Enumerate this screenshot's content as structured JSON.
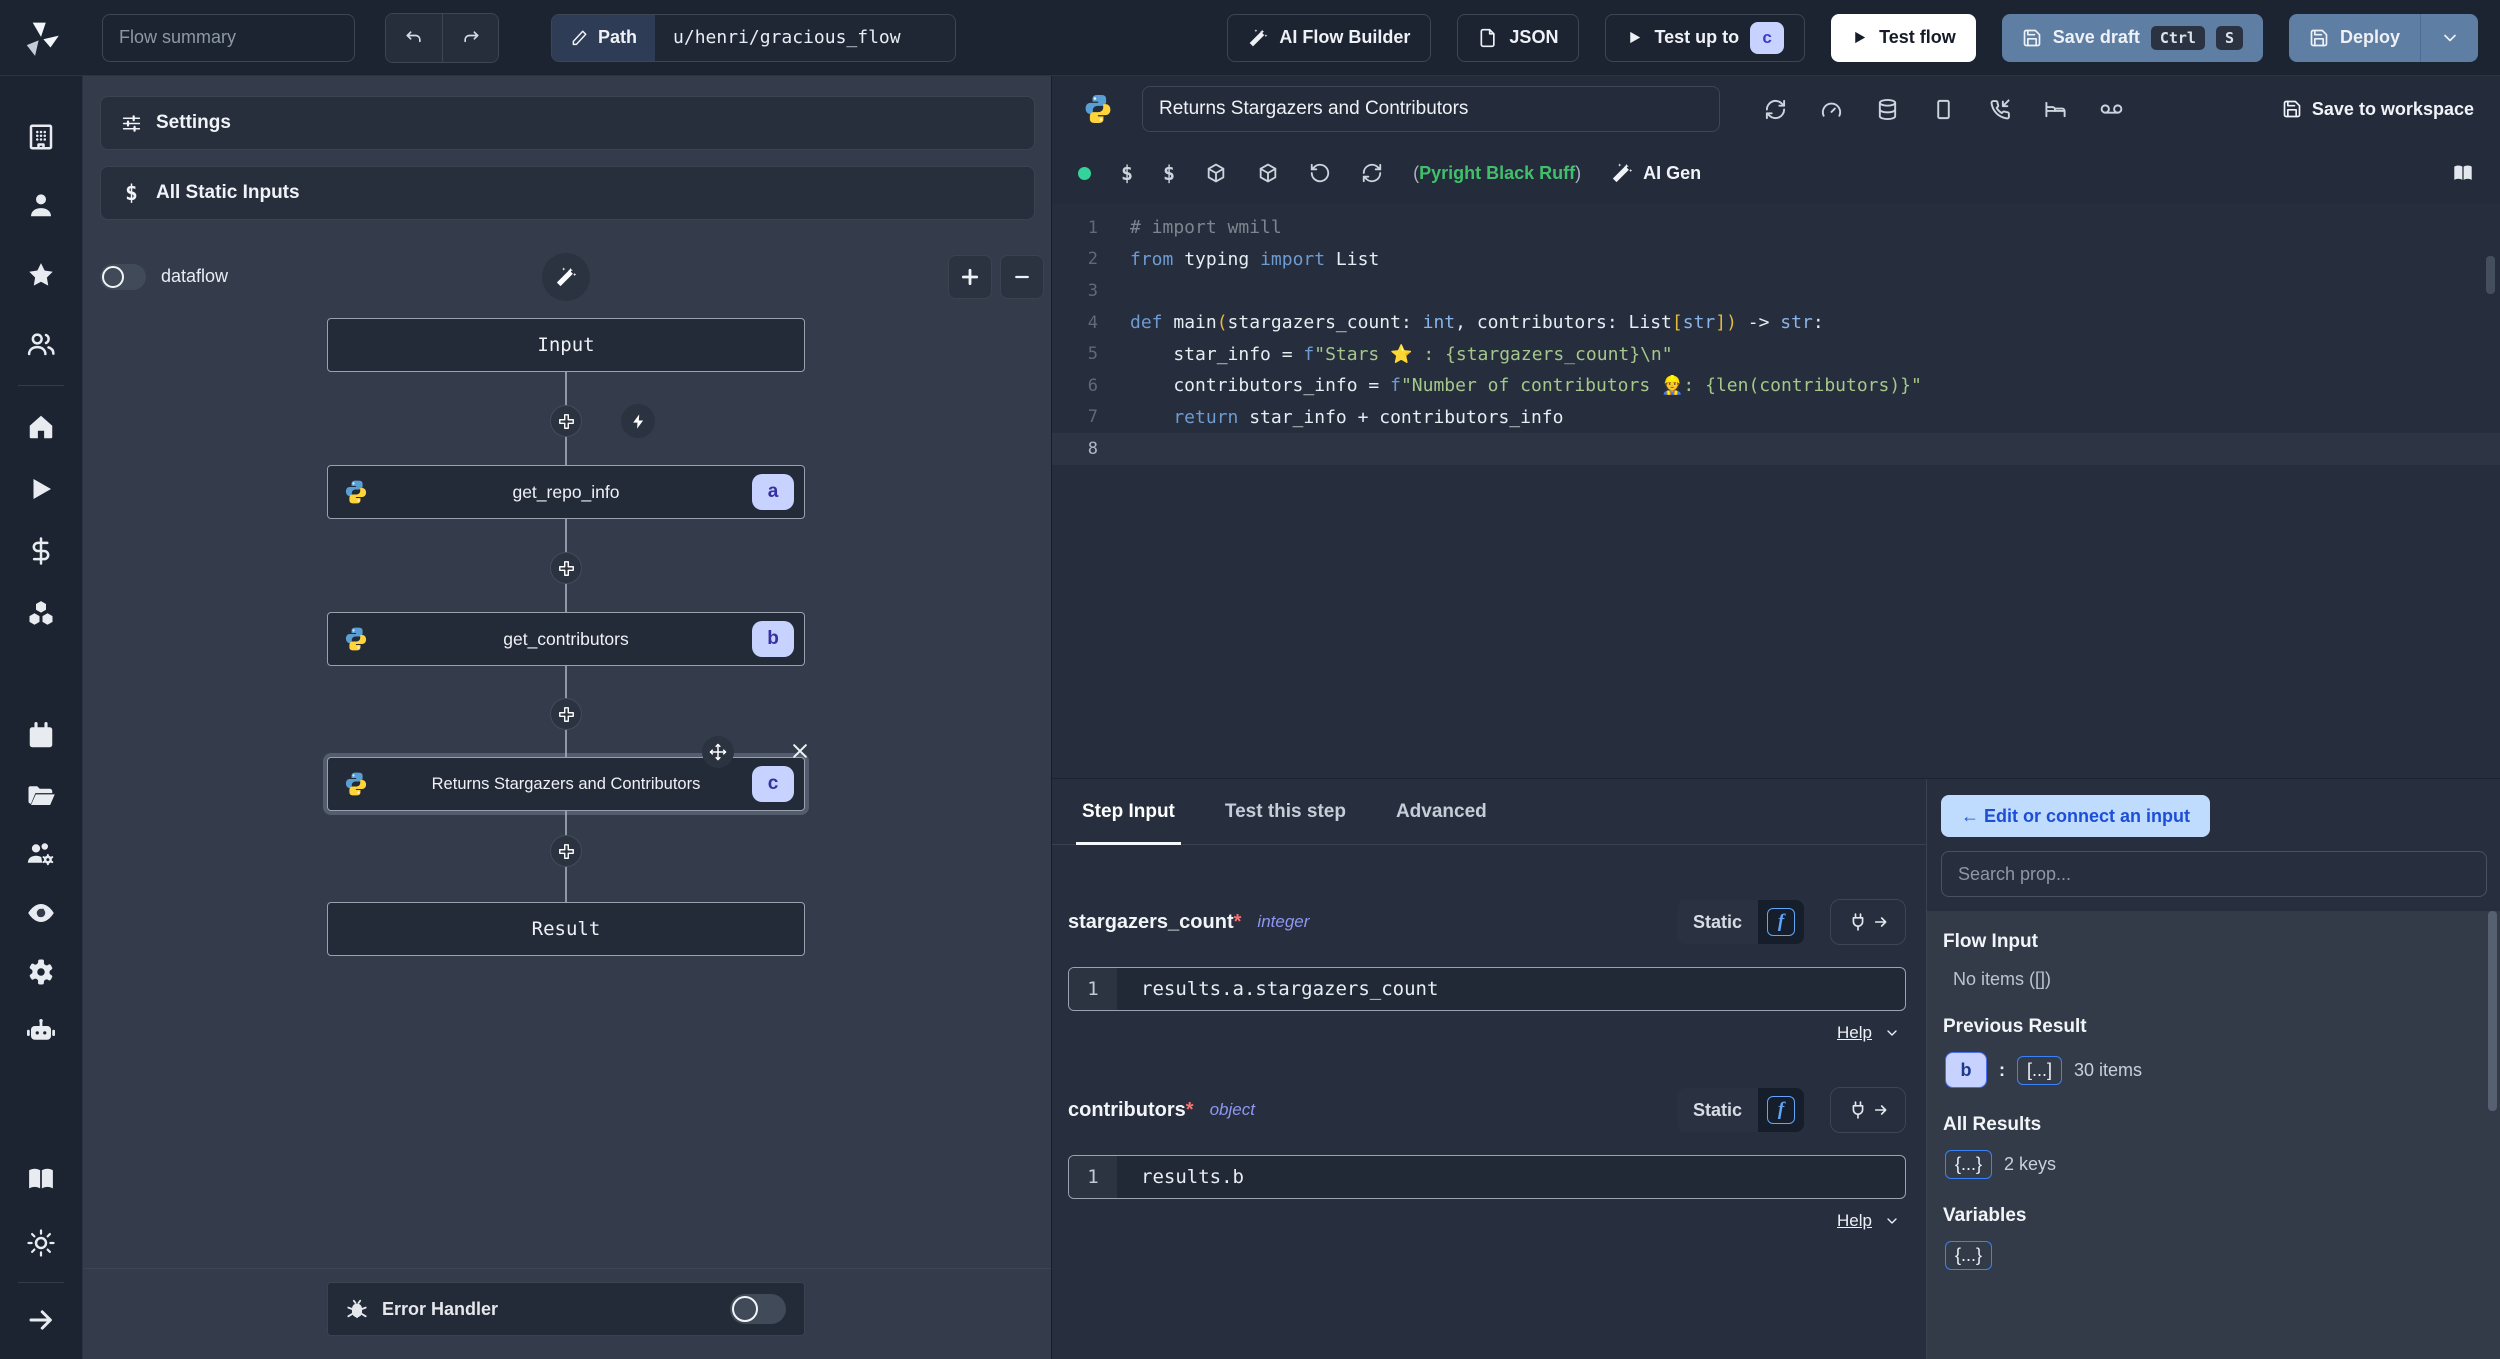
{
  "topbar": {
    "flow_summary_placeholder": "Flow summary",
    "path_label": "Path",
    "path_value": "u/henri/gracious_flow",
    "ai_flow_builder": "AI Flow Builder",
    "json_label": "JSON",
    "test_up_to": "Test up to",
    "test_up_to_badge": "c",
    "test_flow": "Test flow",
    "save_draft": "Save draft",
    "kbd_ctrl": "Ctrl",
    "kbd_s": "S",
    "deploy": "Deploy"
  },
  "graph": {
    "settings": "Settings",
    "all_static_inputs": "All Static Inputs",
    "static_dollar": "$",
    "dataflow_label": "dataflow",
    "input_node": "Input",
    "result_node": "Result",
    "error_handler": "Error Handler",
    "nodes": [
      {
        "label": "get_repo_info",
        "badge": "a"
      },
      {
        "label": "get_contributors",
        "badge": "b"
      },
      {
        "label": "Returns Stargazers and Contributors",
        "badge": "c"
      }
    ]
  },
  "editor": {
    "title": "Returns Stargazers and Contributors",
    "save_to_workspace": "Save to workspace",
    "dollar1": "$",
    "dollar2": "$",
    "assistants_open": "(",
    "assistants_names": "Pyright Black Ruff",
    "assistants_close": ")",
    "ai_gen": "AI Gen",
    "code_lines": [
      {
        "n": "1",
        "t": [
          [
            "com",
            "# import wmill"
          ]
        ]
      },
      {
        "n": "2",
        "t": [
          [
            "kw",
            "from"
          ],
          [
            "pl",
            " typing "
          ],
          [
            "kw",
            "import"
          ],
          [
            "pl",
            " List"
          ]
        ]
      },
      {
        "n": "3",
        "t": []
      },
      {
        "n": "4",
        "t": [
          [
            "kw",
            "def"
          ],
          [
            "pl",
            " main"
          ],
          [
            "br",
            "("
          ],
          [
            "pl",
            "stargazers_count: "
          ],
          [
            "ty",
            "int"
          ],
          [
            "pl",
            ", contributors: List"
          ],
          [
            "br",
            "["
          ],
          [
            "ty",
            "str"
          ],
          [
            "br",
            "]"
          ],
          [
            "br",
            ")"
          ],
          [
            "pl",
            " -> "
          ],
          [
            "ty",
            "str"
          ],
          [
            "pl",
            ":"
          ]
        ]
      },
      {
        "n": "5",
        "t": [
          [
            "pl",
            "    star_info = "
          ],
          [
            "kw",
            "f"
          ],
          [
            "str",
            "\"Stars ⭐ : {stargazers_count}\\n\""
          ]
        ]
      },
      {
        "n": "6",
        "t": [
          [
            "pl",
            "    contributors_info = "
          ],
          [
            "kw",
            "f"
          ],
          [
            "str",
            "\"Number of contributors 👷: {len(contributors)}\""
          ]
        ]
      },
      {
        "n": "7",
        "t": [
          [
            "kw",
            "    return"
          ],
          [
            "pl",
            " star_info + contributors_info"
          ]
        ]
      },
      {
        "n": "8",
        "t": [],
        "active": true
      }
    ]
  },
  "tabs": [
    {
      "label": "Step Input"
    },
    {
      "label": "Test this step"
    },
    {
      "label": "Advanced"
    }
  ],
  "fields": [
    {
      "name": "stargazers_count",
      "required": "*",
      "type": "integer",
      "static_label": "Static",
      "fn_glyph": "f",
      "line_no": "1",
      "value": "results.a.stargazers_count",
      "help": "Help"
    },
    {
      "name": "contributors",
      "required": "*",
      "type": "object",
      "static_label": "Static",
      "fn_glyph": "f",
      "line_no": "1",
      "value": "results.b",
      "help": "Help"
    }
  ],
  "prop_panel": {
    "edit_connect": "← Edit or connect an input",
    "search_placeholder": "Search prop...",
    "flow_input_title": "Flow Input",
    "flow_input_empty": "No items ([])",
    "previous_result_title": "Previous Result",
    "prev_badge": "b",
    "prev_colon": ":",
    "prev_array": "[...]",
    "prev_count": "30 items",
    "all_results_title": "All Results",
    "all_results_badge": "{...}",
    "all_results_count": "2 keys",
    "variables_title": "Variables",
    "variables_badge": "{...}"
  },
  "colors": {
    "accent_blue": "#5f7ea4",
    "badge_lavender": "#c7d2fe",
    "assistant_green": "#41c06c",
    "status_green": "#34d399"
  }
}
